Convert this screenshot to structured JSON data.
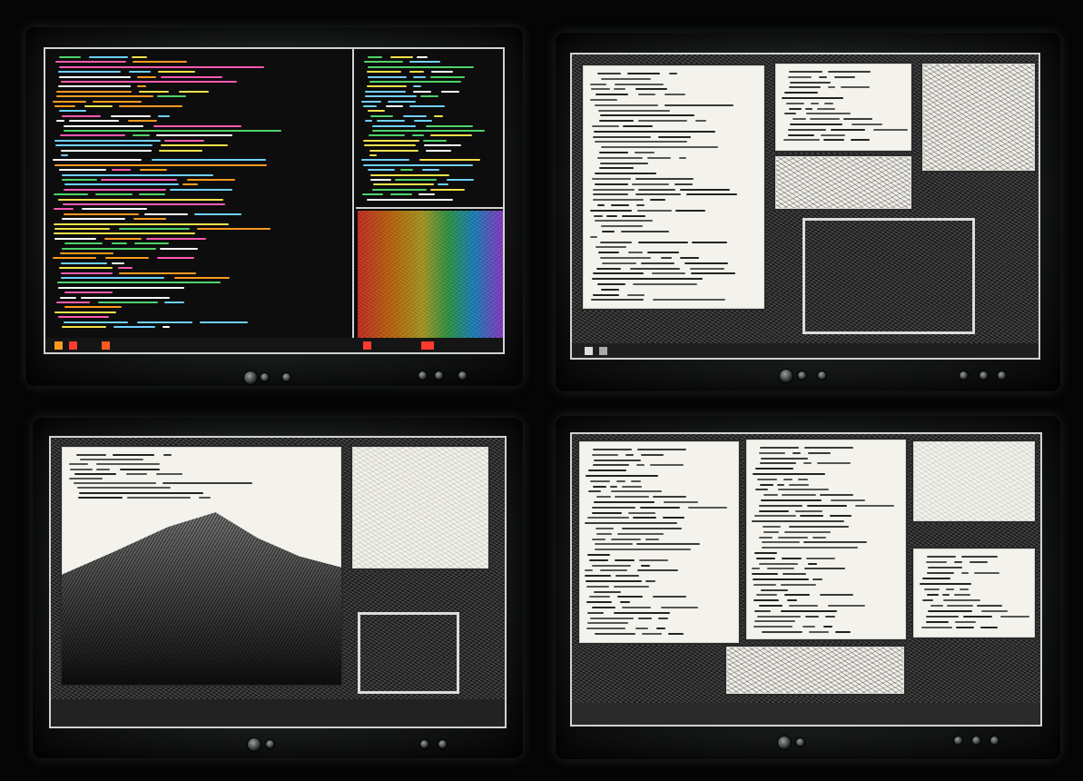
{
  "scene": {
    "panels": [
      "monitor-top-left",
      "monitor-top-right",
      "monitor-bottom-left",
      "monitor-bottom-right"
    ]
  },
  "colors": {
    "code_background": "#0d0d0d",
    "syntax": [
      "#f4e14a",
      "#4fd36a",
      "#ff5ab1",
      "#6fd1ff",
      "#ffffff",
      "#ff9a20"
    ],
    "paper": "#f3f2ec",
    "bezel": "#2a2d2c"
  },
  "icons": [
    "power-knob-icon",
    "button-icon"
  ]
}
